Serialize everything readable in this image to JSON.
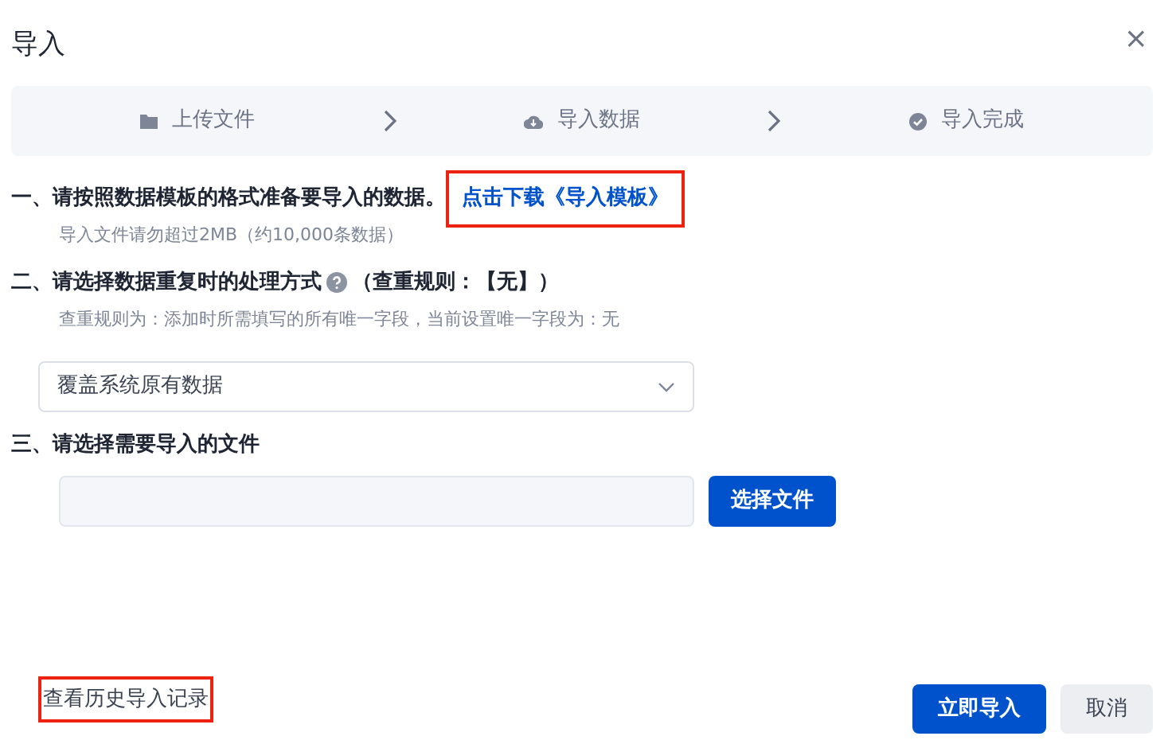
{
  "dialog": {
    "title": "导入",
    "close": "×"
  },
  "steps": [
    {
      "label": "上传文件",
      "kind": "folder"
    },
    {
      "label": "导入数据",
      "kind": "cloud"
    },
    {
      "label": "导入完成",
      "kind": "check"
    }
  ],
  "sections": [
    {
      "heading": "一、请按照数据模板的格式准备要导入的数据。",
      "link": {
        "text": "点击下载《导入模板》",
        "highlighted": true
      },
      "note": "导入文件请勿超过2MB（约10,000条数据）"
    },
    {
      "heading": "二、请选择数据重复时的处理方式",
      "help": true,
      "heading_suffix": "（查重规则：【无】）",
      "note": "查重规则为：添加时所需填写的所有唯一字段，当前设置唯一字段为：无",
      "select": {
        "value": "覆盖系统原有数据"
      }
    },
    {
      "heading": "三、请选择需要导入的文件",
      "file_button": "选择文件"
    }
  ],
  "footer": {
    "history_link": {
      "text": "查看历史导入记录",
      "highlighted": true
    },
    "buttons": [
      {
        "label": "立即导入",
        "kind": "primary"
      },
      {
        "label": "取消",
        "kind": "secondary"
      }
    ]
  }
}
